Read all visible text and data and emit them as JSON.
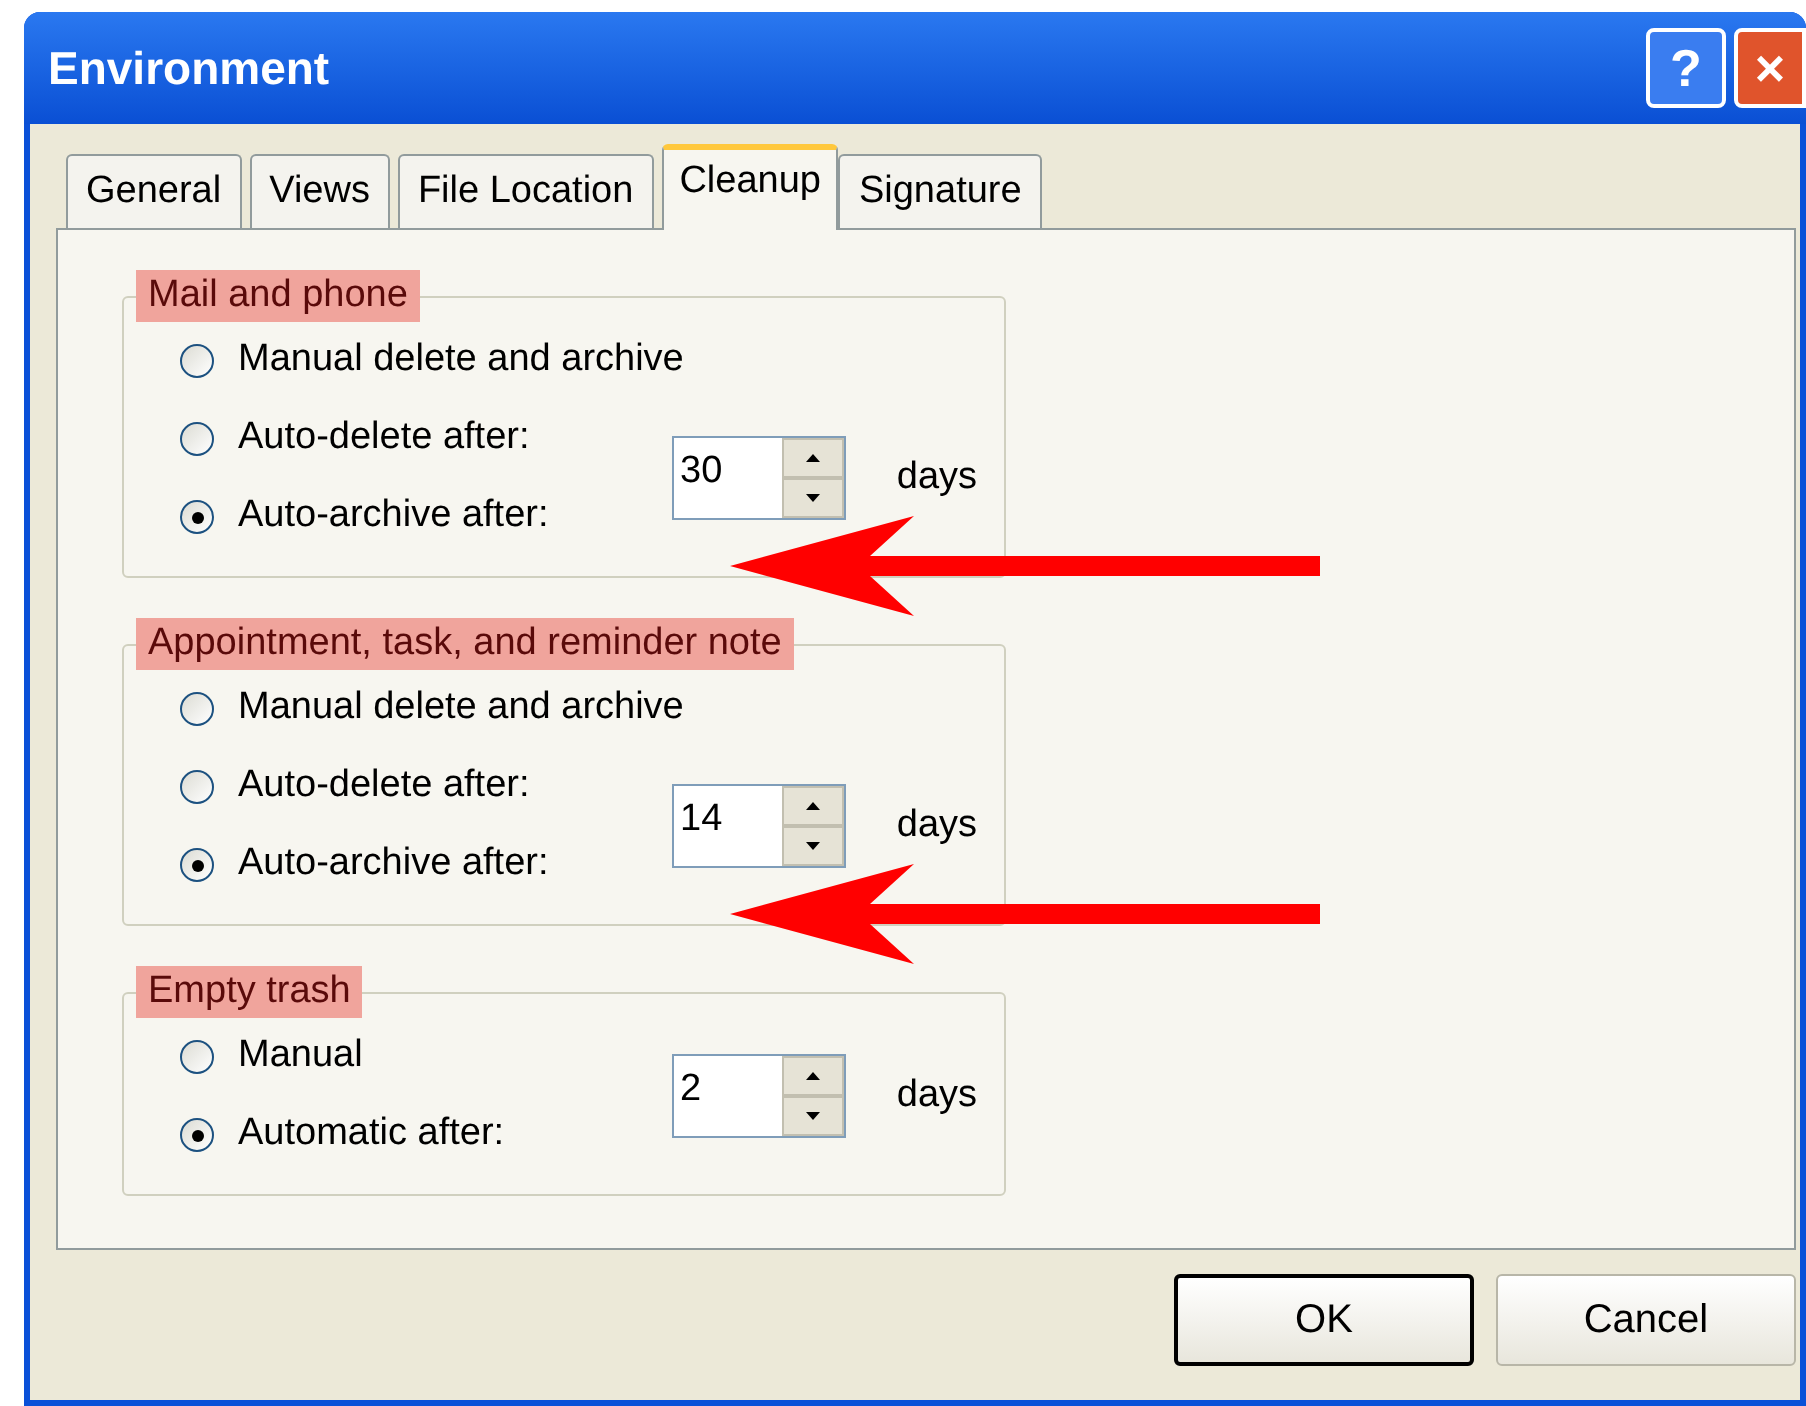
{
  "window": {
    "title": "Environment",
    "controls": [
      "?",
      "×"
    ]
  },
  "tabs": [
    {
      "label": "General",
      "selected": false
    },
    {
      "label": "Views",
      "selected": false
    },
    {
      "label": "File Location",
      "selected": false
    },
    {
      "label": "Cleanup",
      "selected": true
    },
    {
      "label": "Signature",
      "selected": false
    }
  ],
  "groups": [
    {
      "legend": "Mail and phone",
      "highlighted": true,
      "arrow": true,
      "options": [
        {
          "label": "Manual delete and archive",
          "selected": false
        },
        {
          "label": "Auto-delete after:",
          "selected": false
        },
        {
          "label": "Auto-archive after:",
          "selected": true
        }
      ],
      "spin": {
        "value": "30"
      },
      "unit": "days"
    },
    {
      "legend": "Appointment, task, and reminder note",
      "highlighted": true,
      "arrow": true,
      "options": [
        {
          "label": "Manual delete and archive",
          "selected": false
        },
        {
          "label": "Auto-delete after:",
          "selected": false
        },
        {
          "label": "Auto-archive after:",
          "selected": true
        }
      ],
      "spin": {
        "value": "14"
      },
      "unit": "days"
    },
    {
      "legend": "Empty trash",
      "highlighted": true,
      "arrow": false,
      "options": [
        {
          "label": "Manual",
          "selected": false
        },
        {
          "label": "Automatic after:",
          "selected": true
        }
      ],
      "spin": {
        "value": "2"
      },
      "unit": "days"
    }
  ],
  "buttons": [
    {
      "label": "OK",
      "default": true
    },
    {
      "label": "Cancel",
      "default": false
    }
  ]
}
